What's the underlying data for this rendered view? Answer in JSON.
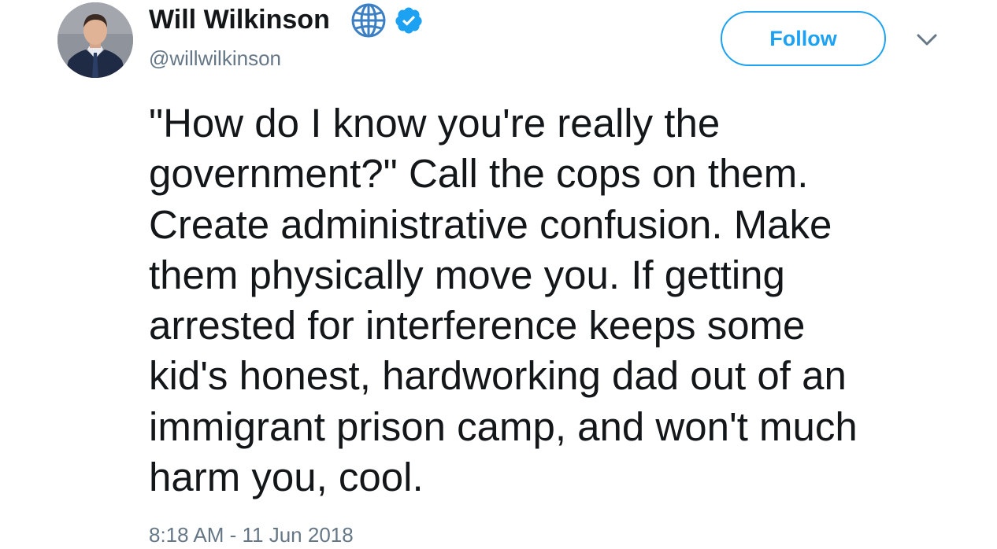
{
  "author": {
    "display_name": "Will Wilkinson",
    "handle": "@willwilkinson",
    "avatar_icon": "avatar",
    "badges": [
      "globe-icon",
      "verified-icon"
    ]
  },
  "actions": {
    "follow_label": "Follow",
    "menu_icon": "chevron-down-icon"
  },
  "tweet": {
    "text": "\"How do I know you're really the\ngovernment?\" Call the cops on them.\nCreate administrative confusion. Make\nthem physically move you. If getting\narrested for interference keeps some\nkid's honest, hardworking dad out of an\nimmigrant prison camp, and won't much\nharm you, cool.",
    "timestamp": "8:18 AM - 11 Jun 2018"
  },
  "colors": {
    "accent": "#1da1f2",
    "text_primary": "#14171a",
    "text_secondary": "#657786",
    "globe": "#3b7fc4"
  }
}
